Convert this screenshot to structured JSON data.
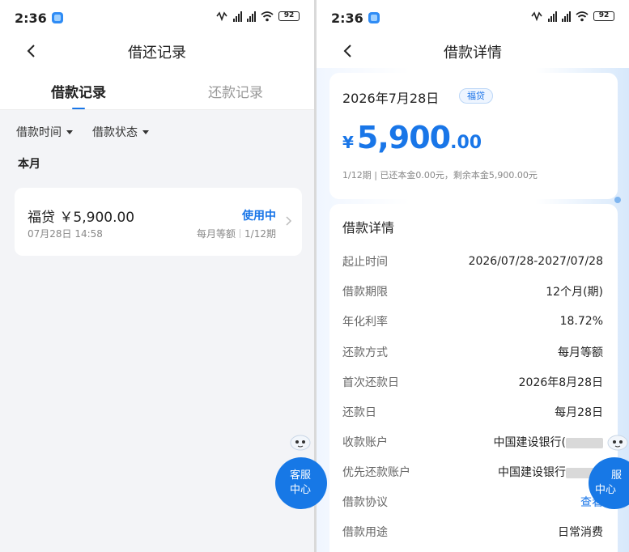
{
  "status_bar": {
    "time": "2:36",
    "battery": "92"
  },
  "left": {
    "nav_title": "借还记录",
    "tabs": [
      {
        "label": "借款记录",
        "active": true
      },
      {
        "label": "还款记录",
        "active": false
      }
    ],
    "filters": [
      "借款时间",
      "借款状态"
    ],
    "section_label": "本月",
    "loan": {
      "title": "福贷 ￥5,900.00",
      "status": "使用中",
      "date": "07月28日 14:58",
      "repayment_type": "每月等额",
      "period": "1/12期"
    },
    "service_button": {
      "line1": "客服",
      "line2": "中心"
    }
  },
  "right": {
    "nav_title": "借款详情",
    "summary": {
      "date": "2026年7月28日",
      "badge": "福贷",
      "currency_symbol": "¥",
      "amount_integer": "5,900",
      "amount_decimal": ".00",
      "note": "1/12期 | 已还本金0.00元，剩余本金5,900.00元"
    },
    "details_heading": "借款详情",
    "details": [
      {
        "label": "起止时间",
        "value": "2026/07/28-2027/07/28"
      },
      {
        "label": "借款期限",
        "value": "12个月(期)"
      },
      {
        "label": "年化利率",
        "value": "18.72%"
      },
      {
        "label": "还款方式",
        "value": "每月等额"
      },
      {
        "label": "首次还款日",
        "value": "2026年8月28日"
      },
      {
        "label": "还款日",
        "value": "每月28日"
      },
      {
        "label": "收款账户",
        "value": "中国建设银行("
      },
      {
        "label": "优先还款账户",
        "value": "中国建设银行"
      },
      {
        "label": "借款协议",
        "value": "查看"
      },
      {
        "label": "借款用途",
        "value": "日常消费"
      }
    ],
    "service_button": {
      "line1": "服",
      "line2": "中心"
    }
  },
  "colors": {
    "accent": "#1976e8",
    "page_bg": "#f3f4f7"
  }
}
